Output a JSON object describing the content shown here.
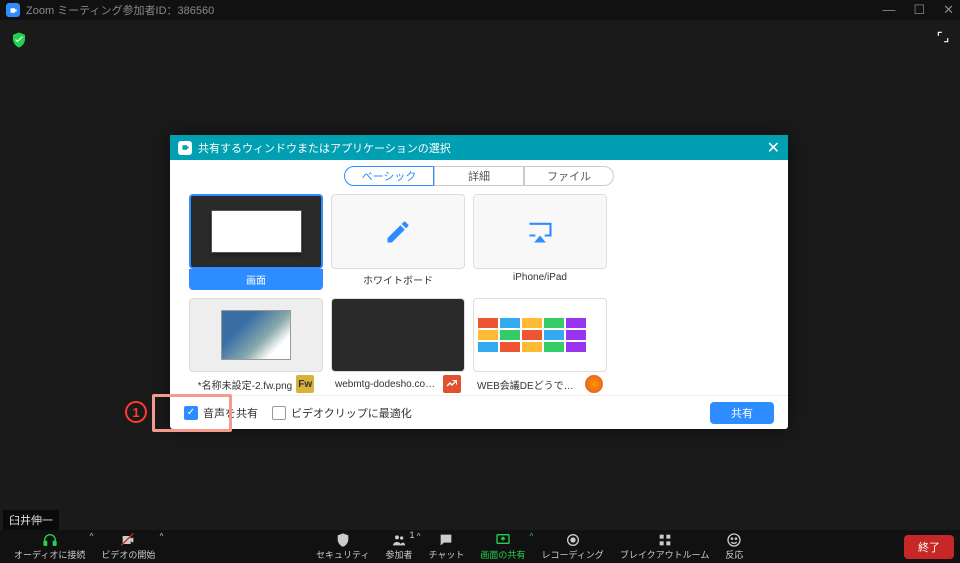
{
  "window": {
    "title": "Zoom ミーティング参加者ID：386560",
    "minimize": "—",
    "maximize": "☐",
    "close": "✕"
  },
  "participant_name": "臼井伸一",
  "dialog": {
    "title": "共有するウィンドウまたはアプリケーションの選択",
    "close": "✕",
    "tabs": {
      "basic": "ベーシック",
      "advanced": "詳細",
      "file": "ファイル"
    },
    "items": {
      "screen": "画面",
      "whiteboard": "ホワイトボード",
      "iphone": "iPhone/iPad",
      "app1": "*名称未設定-2.fw.png",
      "app1_badge": "Fw",
      "app2": "webmtg-dodesho.com - Rank Tra…",
      "app3": "WEB会議DEどうでしょう | この一言…"
    },
    "audio_share": "音声を共有",
    "optimize_video": "ビデオクリップに最適化",
    "share_button": "共有"
  },
  "annotation": {
    "number": "1"
  },
  "toolbar": {
    "audio": "オーディオに接続",
    "video": "ビデオの開始",
    "security": "セキュリティ",
    "participants": "参加者",
    "participants_count": "1",
    "chat": "チャット",
    "share_screen": "画面の共有",
    "record": "レコーディング",
    "breakout": "ブレイクアウトルーム",
    "reactions": "反応",
    "end": "終了"
  }
}
